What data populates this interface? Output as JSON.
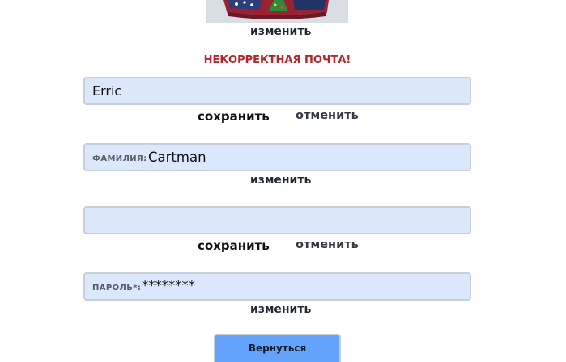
{
  "avatar": {
    "change_label": "изменить"
  },
  "error_message": "НЕКОРРЕКТНАЯ ПОЧТА!",
  "first_name": {
    "value": "Erric",
    "save_label": "сохранить",
    "cancel_label": "отменить"
  },
  "last_name": {
    "label": "ФАМИЛИЯ:",
    "value": "Cartman",
    "change_label": "изменить"
  },
  "email": {
    "value": "",
    "save_label": "сохранить",
    "cancel_label": "отменить"
  },
  "password": {
    "label": "ПАРОЛЬ*:",
    "value": "********",
    "change_label": "изменить"
  },
  "back_button_label": "Вернуться",
  "colors": {
    "field_bg": "#dbe8fc",
    "error": "#b3262b",
    "button_bg": "#63a3fb"
  }
}
